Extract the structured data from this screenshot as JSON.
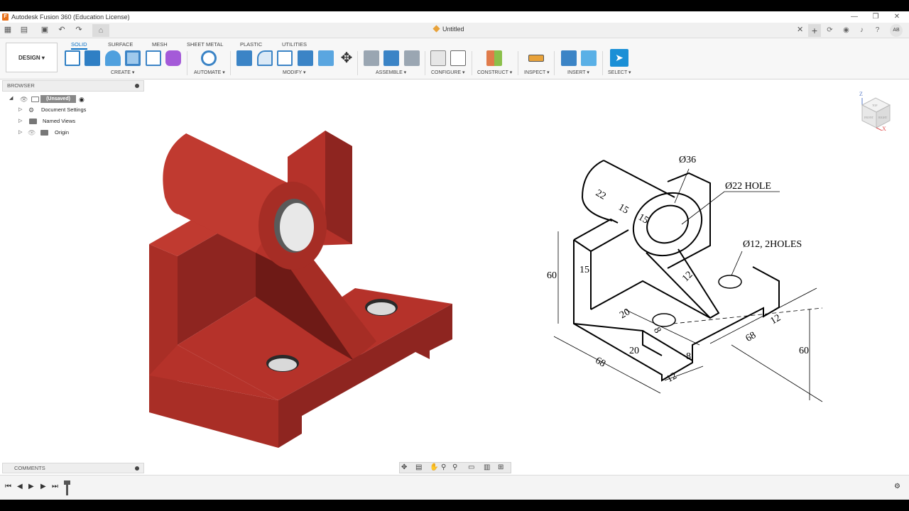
{
  "window": {
    "title": "Autodesk Fusion 360 (Education License)",
    "logo_letter": "F",
    "minimize": "—",
    "restore": "❐",
    "close": "✕"
  },
  "qat": {
    "doc_title": "Untitled",
    "tab_close": "✕",
    "plus": "+",
    "avatar": "AB"
  },
  "ribbon": {
    "workspace": "DESIGN ▾",
    "tabs": [
      "SOLID",
      "SURFACE",
      "MESH",
      "SHEET METAL",
      "PLASTIC",
      "UTILITIES"
    ],
    "groups": [
      "CREATE ▾",
      "AUTOMATE ▾",
      "MODIFY ▾",
      "ASSEMBLE ▾",
      "CONFIGURE ▾",
      "CONSTRUCT ▾",
      "INSPECT ▾",
      "INSERT ▾",
      "SELECT ▾"
    ],
    "colors": {
      "accent": "#0a72c7",
      "select": "#1a8fd6",
      "construct": "#8bbf4a"
    }
  },
  "browser": {
    "title": "BROWSER",
    "root": "(Unsaved)",
    "items": [
      "Document Settings",
      "Named Views",
      "Origin"
    ]
  },
  "comments": {
    "title": "COMMENTS"
  },
  "model": {
    "color": "#b5322a",
    "shade": "#8e2520",
    "dark": "#6e1a16"
  },
  "drawing": {
    "dims": {
      "d36": "Ø36",
      "d22": "Ø22 HOLE",
      "d12": "Ø12, 2HOLES",
      "h60": "60",
      "w68": "68",
      "d68": "68",
      "h60b": "60",
      "t15": "15",
      "a22": "22",
      "a15a": "15",
      "a15b": "15",
      "r12": "12",
      "e20": "20",
      "v20": "20",
      "s8": "8",
      "v8": "8",
      "b12": "12",
      "c12": "12"
    }
  },
  "viewcube": {
    "front": "FRONT",
    "right": "RIGHT",
    "top": "TOP",
    "axis_z": "Z",
    "axis_x": "X"
  }
}
